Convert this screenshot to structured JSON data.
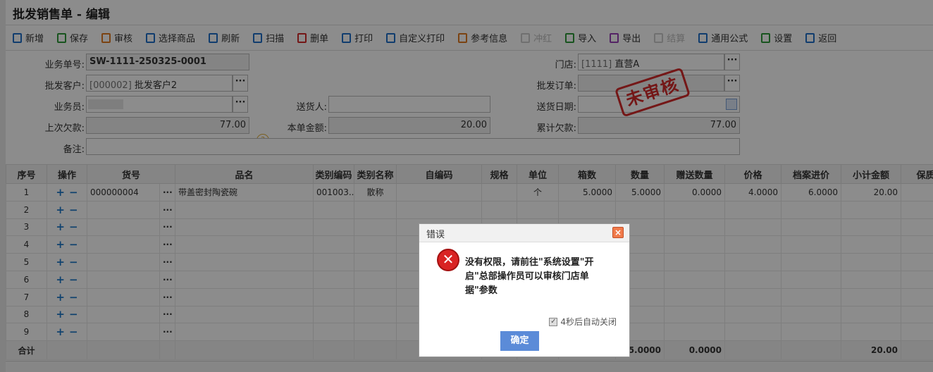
{
  "title": "批发销售单 - 编辑",
  "toolbar": [
    {
      "label": "新增",
      "icon": "new-doc-icon",
      "color": "#1f6fc8",
      "enabled": true
    },
    {
      "label": "保存",
      "icon": "save-icon",
      "color": "#2e9a3a",
      "enabled": true
    },
    {
      "label": "审核",
      "icon": "audit-icon",
      "color": "#e07b22",
      "enabled": true
    },
    {
      "label": "选择商品",
      "icon": "cart-icon",
      "color": "#1f6fc8",
      "enabled": true
    },
    {
      "label": "刷新",
      "icon": "refresh-icon",
      "color": "#1f6fc8",
      "enabled": true
    },
    {
      "label": "扫描",
      "icon": "scan-icon",
      "color": "#1f6fc8",
      "enabled": true
    },
    {
      "label": "删单",
      "icon": "delete-doc-icon",
      "color": "#d42a2a",
      "enabled": true
    },
    {
      "label": "打印",
      "icon": "print-icon",
      "color": "#1f6fc8",
      "enabled": true
    },
    {
      "label": "自定义打印",
      "icon": "custom-print-icon",
      "color": "#1f6fc8",
      "enabled": true
    },
    {
      "label": "参考信息",
      "icon": "info-icon",
      "color": "#e07b22",
      "enabled": true
    },
    {
      "label": "冲红",
      "icon": "reverse-icon",
      "color": "#d42a2a",
      "enabled": false
    },
    {
      "label": "导入",
      "icon": "import-icon",
      "color": "#2e9a3a",
      "enabled": true
    },
    {
      "label": "导出",
      "icon": "export-icon",
      "color": "#9a40b8",
      "enabled": true
    },
    {
      "label": "结算",
      "icon": "settle-icon",
      "color": "#1f6fc8",
      "enabled": false
    },
    {
      "label": "通用公式",
      "icon": "formula-icon",
      "color": "#1f6fc8",
      "enabled": true
    },
    {
      "label": "设置",
      "icon": "settings-icon",
      "color": "#2e9a3a",
      "enabled": true
    },
    {
      "label": "返回",
      "icon": "back-icon",
      "color": "#1f6fc8",
      "enabled": true
    }
  ],
  "form": {
    "doc_no_label": "业务单号:",
    "doc_no": "SW-1111-250325-0001",
    "customer_label": "批发客户:",
    "customer_code": "[000002]",
    "customer_name": "批发客户2",
    "salesman_label": "业务员:",
    "prev_debt_label": "上次欠款:",
    "prev_debt": "77.00",
    "remark_label": "备注:",
    "deliverer_label": "送货人:",
    "amount_label": "本单金额:",
    "amount": "20.00",
    "store_label": "门店:",
    "store_code": "[1111]",
    "store_name": "直营A",
    "order_label": "批发订单:",
    "delivery_date_label": "送货日期:",
    "total_debt_label": "累计欠款:",
    "total_debt": "77.00",
    "help": "?",
    "stamp": "未审核"
  },
  "table": {
    "columns": [
      "序号",
      "操作",
      "货号",
      "品名",
      "类别编码",
      "类别名称",
      "自编码",
      "规格",
      "单位",
      "箱数",
      "数量",
      "赠送数量",
      "价格",
      "档案进价",
      "小计金额",
      "保质"
    ],
    "rows": [
      {
        "no": "1",
        "code": "000000004",
        "name": "带盖密封陶瓷碗",
        "cat_code": "001003...",
        "cat_name": "散称",
        "self_code": "",
        "spec": "",
        "unit": "个",
        "boxes": "5.0000",
        "qty": "5.0000",
        "gift": "0.0000",
        "price": "4.0000",
        "cost": "6.0000",
        "subtotal": "20.00"
      },
      {
        "no": "2"
      },
      {
        "no": "3"
      },
      {
        "no": "4"
      },
      {
        "no": "5"
      },
      {
        "no": "6"
      },
      {
        "no": "7"
      },
      {
        "no": "8"
      },
      {
        "no": "9"
      }
    ],
    "plus": "+",
    "minus": "−",
    "dots": "···",
    "footer": {
      "label": "合计",
      "qty": "5.0000",
      "gift": "0.0000",
      "subtotal": "20.00"
    }
  },
  "dialog": {
    "title": "错误",
    "message": "没有权限，请前往\"系统设置\"开启\"总部操作员可以审核门店单据\"参数",
    "auto_close": "4秒后自动关闭",
    "ok": "确定",
    "close": "×",
    "error_mark": "✕"
  }
}
